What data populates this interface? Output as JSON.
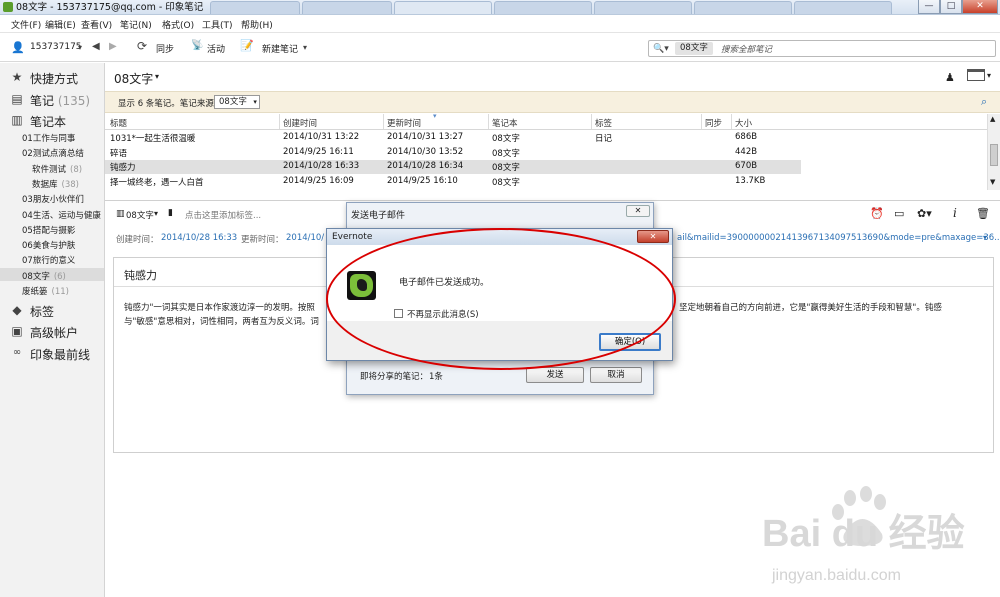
{
  "window": {
    "title": "08文字 - 153737175@qq.com - 印象笔记",
    "controls": [
      "—",
      "□",
      "✕"
    ]
  },
  "menu": [
    "文件(F)",
    "编辑(E)",
    "查看(V)",
    "笔记(N)",
    "格式(O)",
    "工具(T)",
    "帮助(H)"
  ],
  "toolbar": {
    "user": "153737175",
    "sync": "同步",
    "activity": "活动",
    "new_note": "新建笔记"
  },
  "search": {
    "scope": "08文字",
    "placeholder": "搜索全部笔记"
  },
  "sidebar": {
    "shortcuts": "快捷方式",
    "notes": "笔记",
    "notes_count": "(135)",
    "notebooks": "笔记本",
    "items": [
      {
        "label": "01工作与同事",
        "count": ""
      },
      {
        "label": "02测试点滴总结",
        "count": ""
      },
      {
        "label": "软件测试",
        "count": "(8)",
        "indent": true
      },
      {
        "label": "数据库",
        "count": "(38)",
        "indent": true
      },
      {
        "label": "03朋友小伙伴们",
        "count": ""
      },
      {
        "label": "04生活、运动与健康",
        "count": ""
      },
      {
        "label": "05搭配与摄影",
        "count": ""
      },
      {
        "label": "06美食与护肤",
        "count": ""
      },
      {
        "label": "07旅行的意义",
        "count": ""
      },
      {
        "label": "08文字",
        "count": "(6)",
        "selected": true
      },
      {
        "label": "废纸篓",
        "count": "(11)"
      }
    ],
    "tags": "标签",
    "premium": "高级帐户",
    "atlas": "印象最前线"
  },
  "list": {
    "notebook_title": "08文字",
    "filter_text": "显示 6 条笔记。笔记来源：",
    "filter_value": "08文字",
    "columns": [
      "标题",
      "创建时间",
      "更新时间",
      "笔记本",
      "标签",
      "同步",
      "大小"
    ],
    "rows": [
      [
        "1031*一起生活很温暖",
        "2014/10/31 13:22",
        "2014/10/31 13:27",
        "08文字",
        "日记",
        "",
        "686B"
      ],
      [
        "碎语",
        "2014/9/25 16:11",
        "2014/10/30 13:52",
        "08文字",
        "",
        "",
        "442B"
      ],
      [
        "钝感力",
        "2014/10/28 16:33",
        "2014/10/28 16:34",
        "08文字",
        "",
        "",
        "670B"
      ],
      [
        "择一城终老，遇一人白首",
        "2014/9/25 16:09",
        "2014/9/25 16:10",
        "08文字",
        "",
        "",
        "13.7KB"
      ]
    ]
  },
  "note": {
    "notebook": "08文字",
    "tag_placeholder": "点击这里添加标签...",
    "created_label": "创建时间：",
    "created_value": "2014/10/28 16:33",
    "updated_label": "更新时间：",
    "updated_value": "2014/10/",
    "url_tail": "ail&mailid=39000000021413967134097513690&mode=pre&maxage=36...",
    "title": "钝感力",
    "body_line1": "钝感力\"一词其实是日本作家渡边淳一的发明。按照",
    "body_line1_right": "坚定地朝着自己的方向前进，它是\"赢得美好生活的手段和智慧\"。钝感",
    "body_line2": "与\"敏感\"意思相对，词性相同，两者互为反义词。词"
  },
  "email_dialog": {
    "title": "发送电子邮件",
    "share_label": "即将分享的笔记：",
    "share_count": "1条",
    "send": "发送",
    "cancel": "取消"
  },
  "alert": {
    "title": "Evernote",
    "message": "电子邮件已发送成功。",
    "checkbox": "不再显示此消息(S)",
    "ok": "确定(O)"
  },
  "watermark": {
    "brand": "Bai du 经验",
    "url": "jingyan.baidu.com"
  }
}
